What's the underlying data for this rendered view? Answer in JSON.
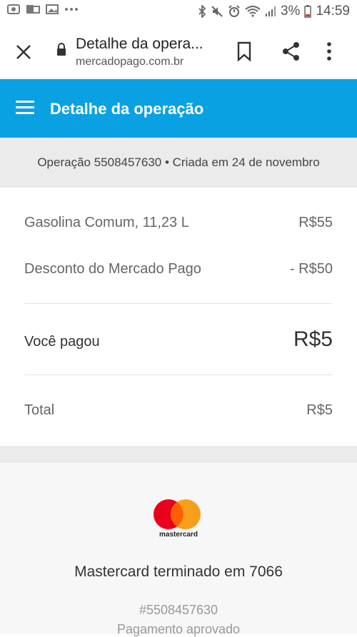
{
  "status_bar": {
    "battery": "3%",
    "time": "14:59"
  },
  "browser": {
    "title": "Detalhe da opera...",
    "url": "mercadopago.com.br"
  },
  "app": {
    "title": "Detalhe da operação"
  },
  "operation": {
    "info": "Operação 5508457630 • Criada em 24 de novembro"
  },
  "summary": {
    "items": [
      {
        "label": "Gasolina Comum, 11,23 L",
        "value": "R$55"
      },
      {
        "label": "Desconto do Mercado Pago",
        "value": "- R$50"
      }
    ],
    "paid_label": "Você pagou",
    "paid_value": "R$5",
    "total_label": "Total",
    "total_value": "R$5"
  },
  "payment": {
    "brand": "mastercard",
    "card_name": "Mastercard terminado em 7066",
    "operation_number": "#5508457630",
    "status": "Pagamento aprovado"
  }
}
